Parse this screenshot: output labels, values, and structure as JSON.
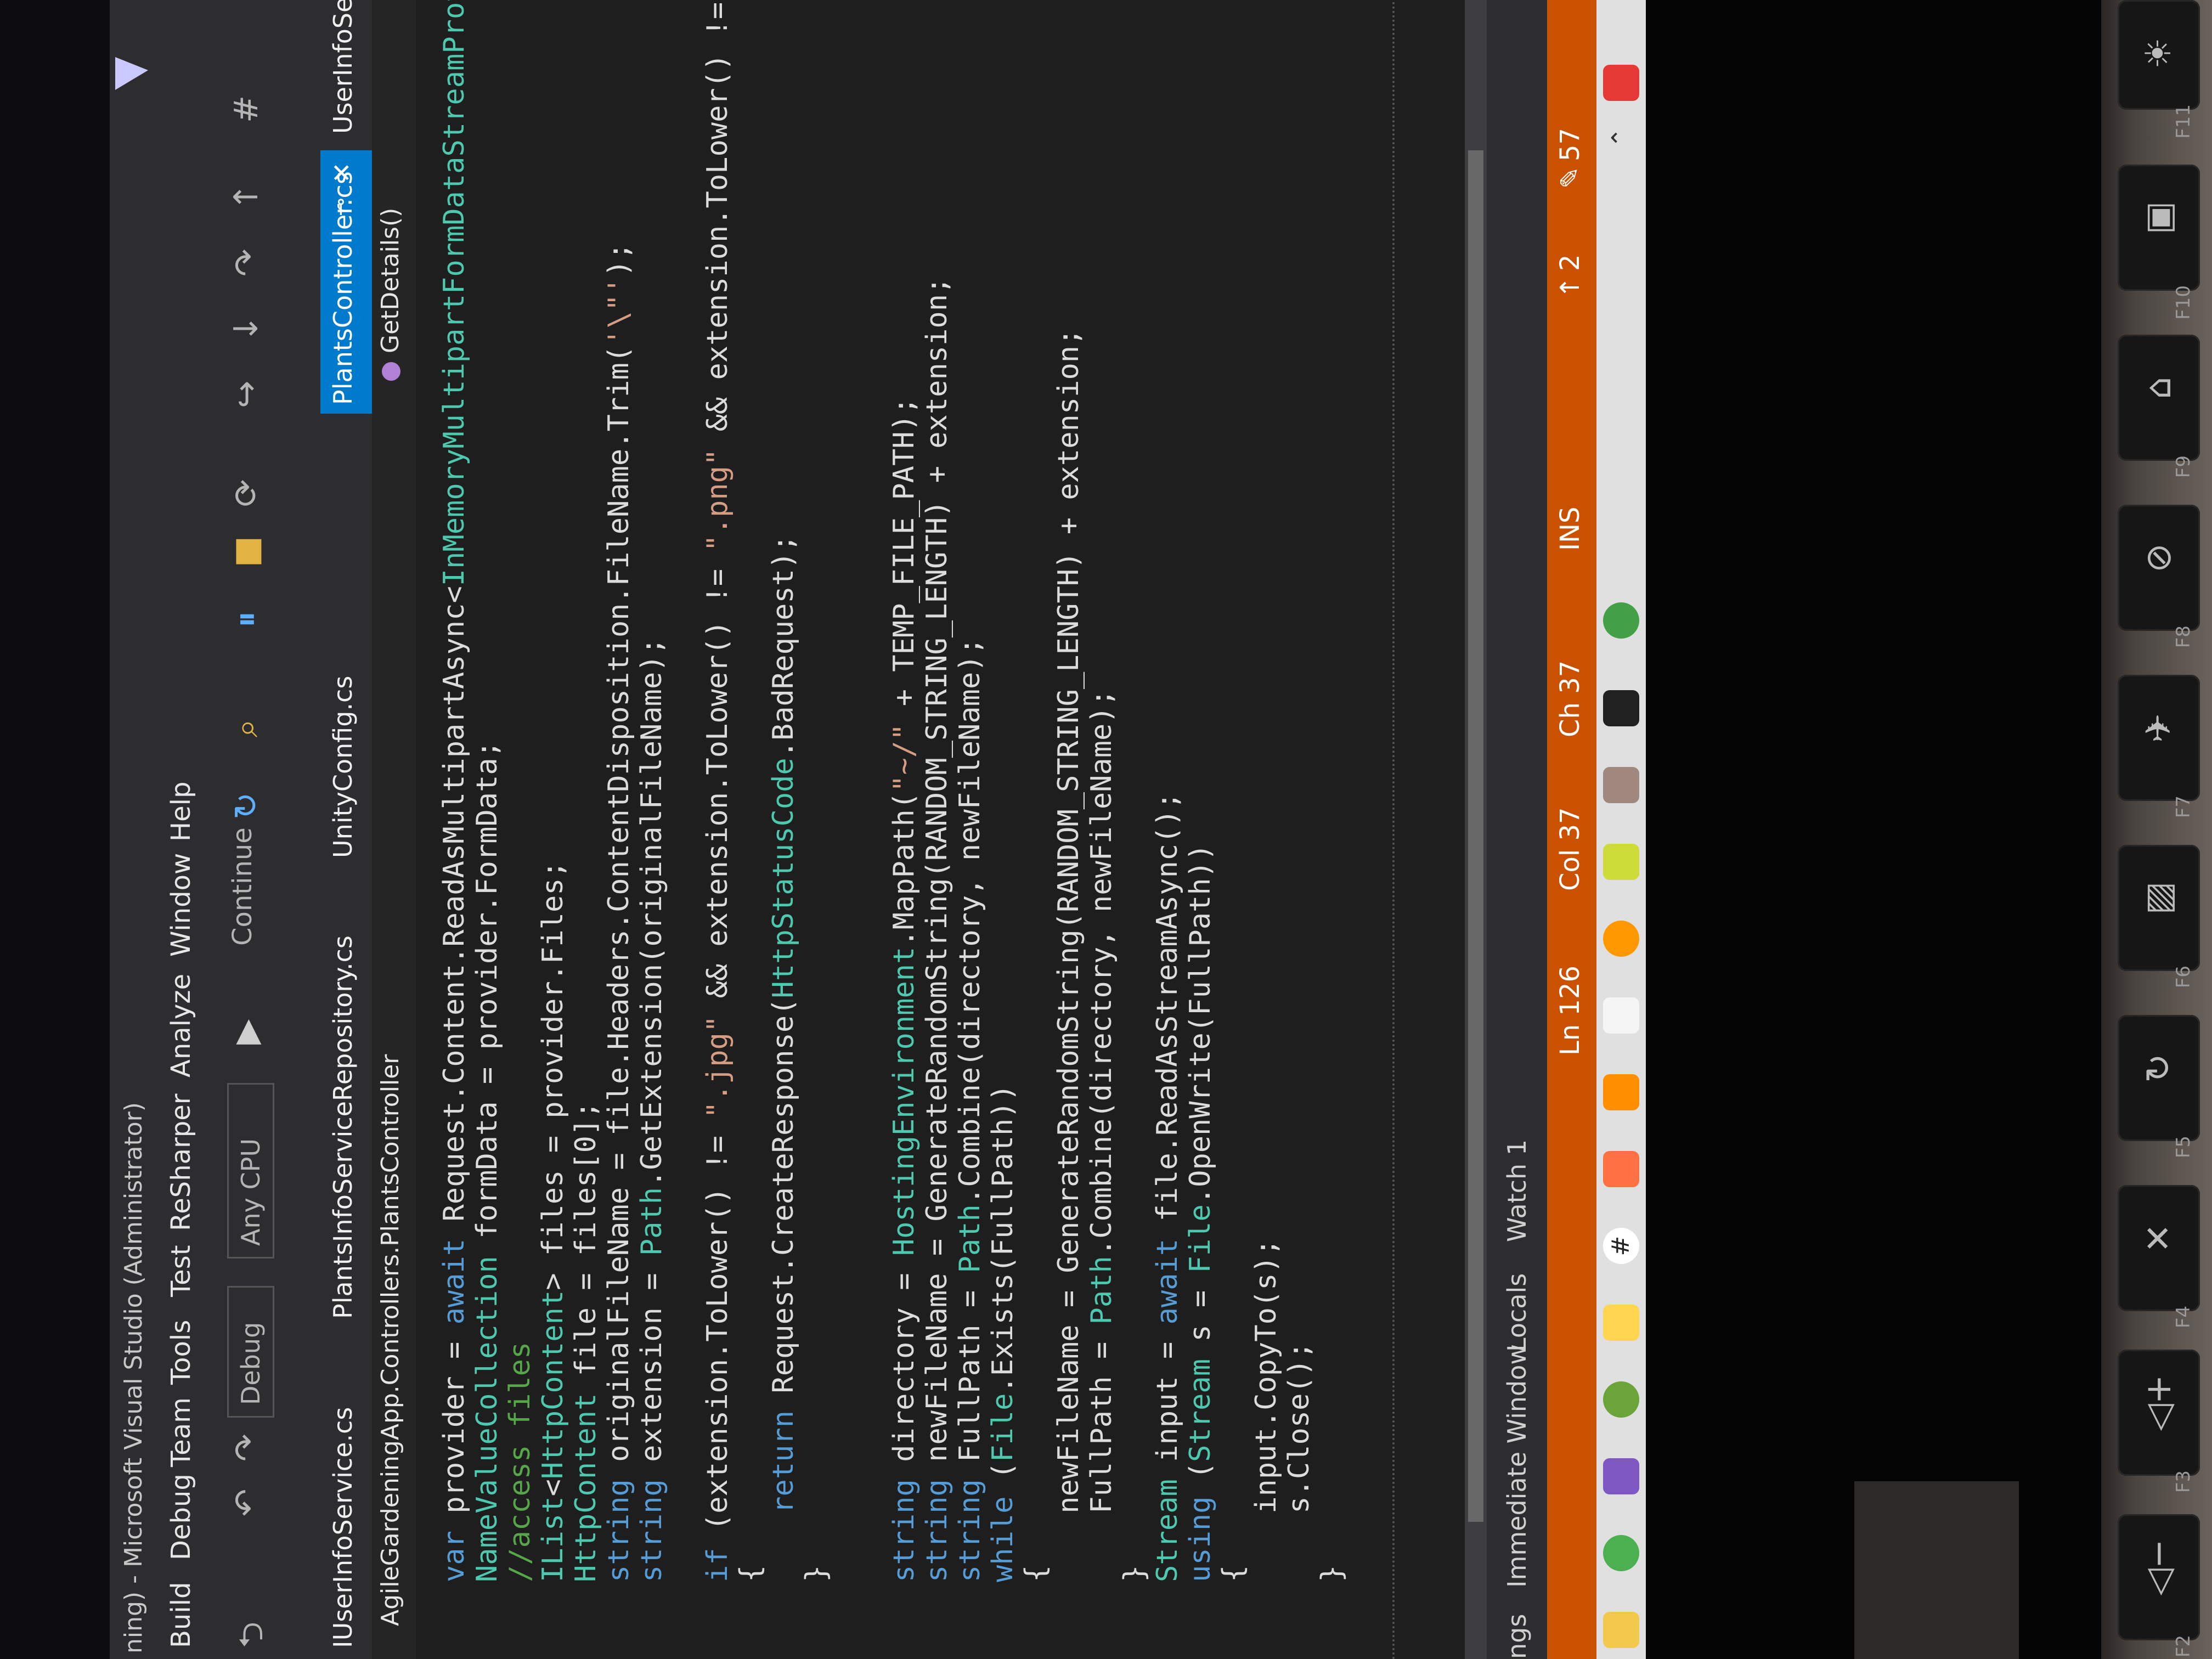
{
  "window": {
    "title": "ning) - Microsoft Visual Studio (Administrator)"
  },
  "menu": [
    "Build",
    "Debug",
    "Team",
    "Tools",
    "Test",
    "ReSharper",
    "Analyze",
    "Window",
    "Help"
  ],
  "toolbar": {
    "config": "Debug",
    "platform": "Any CPU",
    "continue_label": "Continue"
  },
  "tabs": {
    "items": [
      "IUserInfoService.cs",
      "PlantsInfoServiceRepository.cs",
      "UnityConfig.cs"
    ],
    "active": "PlantsController.cs",
    "right": "UserInfoServic"
  },
  "nav": {
    "left": "AgileGardeningApp.Controllers.PlantsController",
    "right": "GetDetails()"
  },
  "code": [
    "var provider = await Request.Content.ReadAsMultipartAsync<InMemoryMultipartFormDataStreamProvider",
    "NameValueCollection formData = provider.FormData;",
    "//access files",
    "IList<HttpContent> files = provider.Files;",
    "HttpContent file = files[0];",
    "string originalFileName = file.Headers.ContentDisposition.FileName.Trim('\\\"');",
    "string extension = Path.GetExtension(originalFileName);",
    "",
    "if (extension.ToLower() != \".jpg\" && extension.ToLower() != \".png\" && extension.ToLower() != \".jpe",
    "{",
    "    return Request.CreateResponse(HttpStatusCode.BadRequest);",
    "}",
    "",
    "",
    "string directory = HostingEnvironment.MapPath(\"~/\" + TEMP_FILE_PATH);",
    "string newFileName = GenerateRandomString(RANDOM_STRING_LENGTH) + extension;",
    "string FullPath = Path.Combine(directory, newFileName);",
    "while (File.Exists(FullPath))",
    "{",
    "    newFileName = GenerateRandomString(RANDOM_STRING_LENGTH) + extension;",
    "    FullPath = Path.Combine(directory, newFileName);",
    "}",
    "Stream input = await file.ReadAsStreamAsync();",
    "using (Stream s = File.OpenWrite(FullPath))",
    "{",
    "    input.CopyTo(s);",
    "    s.Close();",
    "}"
  ],
  "toolwindows": [
    "ngs",
    "Immediate Window",
    "Locals",
    "Watch 1"
  ],
  "status": {
    "ln": "Ln 126",
    "col": "Col 37",
    "ch": "Ch 37",
    "ins": "INS",
    "up": "2",
    "edits": "57"
  },
  "keys": [
    "F2",
    "F3",
    "F4",
    "F5",
    "F6",
    "F7",
    "F8",
    "F9",
    "F10",
    "F11"
  ],
  "colors": {
    "accent": "#007acc",
    "status": "#ca5100",
    "keyword": "#569cd6",
    "type": "#4ec9b0",
    "string": "#d69d85",
    "comment": "#57a64a"
  }
}
